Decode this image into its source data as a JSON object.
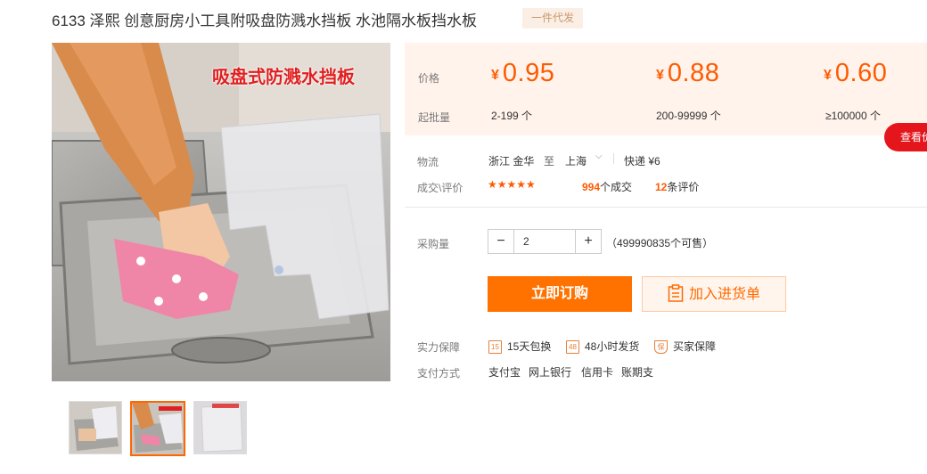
{
  "product": {
    "title": "6133 泽熙 创意厨房小工具附吸盘防溅水挡板 水池隔水板挡水板",
    "badge": "一件代发",
    "image_caption": "吸盘式防溅水挡板"
  },
  "price_table": {
    "price_label": "价格",
    "qty_label": "起批量",
    "tiers": [
      {
        "currency": "¥",
        "price": "0.95",
        "qty": "2-199 个"
      },
      {
        "currency": "¥",
        "price": "0.88",
        "qty": "200-99999 个"
      },
      {
        "currency": "¥",
        "price": "0.60",
        "qty": "≥100000 个"
      }
    ]
  },
  "view_more": "查看价格",
  "logistics": {
    "label": "物流",
    "from": "浙江 金华",
    "to_word": "至",
    "to": "上海",
    "express": "快递 ¥6"
  },
  "deals": {
    "label": "成交\\评价",
    "stars": "★★★★★",
    "deal_count": "994",
    "deal_suffix": "个成交",
    "review_count": "12",
    "review_suffix": "条评价"
  },
  "purchase": {
    "label": "采购量",
    "quantity": "2",
    "available": "（499990835个可售）",
    "minus": "−",
    "plus": "+"
  },
  "buttons": {
    "buy_now": "立即订购",
    "add_to_list": "加入进货单"
  },
  "guarantee": {
    "label": "实力保障",
    "items": [
      {
        "icon": "15",
        "text": "15天包换"
      },
      {
        "icon": "48",
        "text": "48小时发货"
      },
      {
        "icon": "保",
        "text": "买家保障"
      }
    ]
  },
  "payment": {
    "label": "支付方式",
    "methods": [
      "支付宝",
      "网上银行",
      "信用卡",
      "账期支"
    ]
  },
  "colors": {
    "accent_orange": "#ff5a00",
    "button_orange": "#ff7200",
    "price_bg": "#fff3eb",
    "view_more_red": "#e4161c"
  }
}
